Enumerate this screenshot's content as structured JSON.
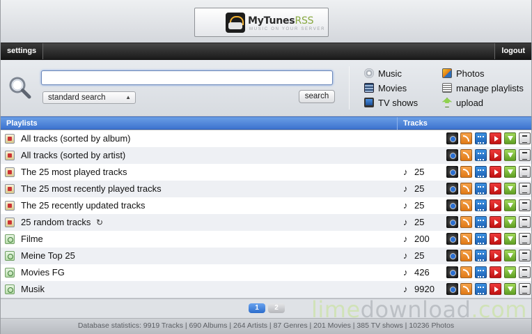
{
  "header": {
    "logo_name": "MyTunes",
    "logo_suffix": "RSS",
    "logo_tagline": "music on your server"
  },
  "topnav": {
    "settings_label": "settings",
    "logout_label": "logout"
  },
  "search": {
    "input_value": "",
    "mode_selected": "standard search",
    "button_label": "search"
  },
  "quicklinks": {
    "music": "Music",
    "movies": "Movies",
    "tvshows": "TV shows",
    "photos": "Photos",
    "manage": "manage playlists",
    "upload": "upload"
  },
  "table": {
    "col_playlists": "Playlists",
    "col_tracks": "Tracks",
    "rows": [
      {
        "name": "All tracks (sorted by album)",
        "tracks": "",
        "kind": "smart"
      },
      {
        "name": "All tracks (sorted by artist)",
        "tracks": "",
        "kind": "smart"
      },
      {
        "name": "The 25 most played tracks",
        "tracks": "25",
        "kind": "smart"
      },
      {
        "name": "The 25 most recently played tracks",
        "tracks": "25",
        "kind": "smart"
      },
      {
        "name": "The 25 recently updated tracks",
        "tracks": "25",
        "kind": "smart"
      },
      {
        "name": "25 random tracks",
        "tracks": "25",
        "kind": "smart",
        "refresh": true
      },
      {
        "name": "Filme",
        "tracks": "200",
        "kind": "normal"
      },
      {
        "name": "Meine Top 25",
        "tracks": "25",
        "kind": "normal"
      },
      {
        "name": "Movies FG",
        "tracks": "426",
        "kind": "normal"
      },
      {
        "name": "Musik",
        "tracks": "9920",
        "kind": "normal"
      }
    ]
  },
  "pager": {
    "pages": [
      "1",
      "2"
    ],
    "current": "1"
  },
  "watermark": {
    "part1": "lime",
    "part2": "download",
    "part3": ".com"
  },
  "footer": {
    "statistics": "Database statistics: 9919 Tracks | 690 Albums | 264 Artists | 87 Genres | 201 Movies | 385 TV shows | 10236 Photos"
  },
  "colors": {
    "header_bar_blue": "#3d73cf",
    "nav_black": "#1a1a1a",
    "row_alt": "#eef0f4"
  }
}
